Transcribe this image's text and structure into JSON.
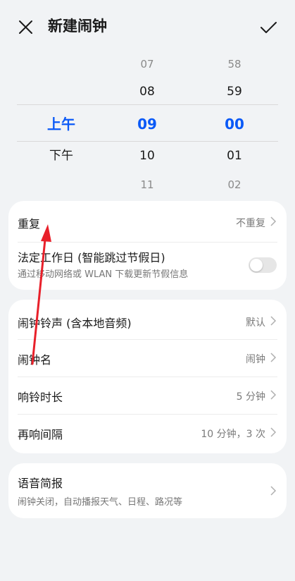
{
  "header": {
    "title": "新建闹钟",
    "close_icon": "close-icon",
    "confirm_icon": "check-icon"
  },
  "picker": {
    "ampm": {
      "selected": "上午",
      "below": "下午"
    },
    "hours": [
      "07",
      "08",
      "09",
      "10",
      "11"
    ],
    "minutes": [
      "58",
      "59",
      "00",
      "01",
      "02"
    ],
    "selected_color": "#0a59f7"
  },
  "card1": {
    "repeat": {
      "label": "重复",
      "value": "不重复"
    },
    "workday": {
      "label": "法定工作日 (智能跳过节假日)",
      "sub": "通过移动网络或 WLAN 下载更新节假信息",
      "enabled": false
    }
  },
  "card2": {
    "ringtone": {
      "label": "闹钟铃声 (含本地音频)",
      "value": "默认"
    },
    "name": {
      "label": "闹钟名",
      "value": "闹钟"
    },
    "duration": {
      "label": "响铃时长",
      "value": "5 分钟"
    },
    "snooze": {
      "label": "再响间隔",
      "value": "10 分钟，3 次"
    }
  },
  "card3": {
    "voice": {
      "label": "语音简报",
      "sub": "闹钟关闭，自动播报天气、日程、路况等"
    }
  },
  "annotation": {
    "color": "#e8202a"
  }
}
